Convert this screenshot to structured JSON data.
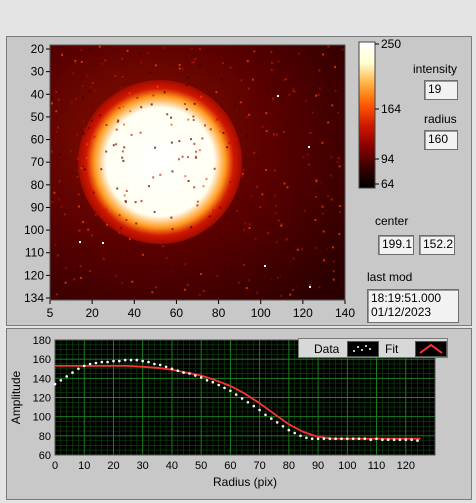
{
  "image_axes": {
    "x_ticks": [
      "5",
      "20",
      "40",
      "60",
      "80",
      "100",
      "120",
      "140"
    ],
    "y_ticks": [
      "20",
      "30",
      "40",
      "50",
      "60",
      "70",
      "80",
      "90",
      "100",
      "110",
      "120",
      "134"
    ]
  },
  "colorbar": {
    "ticks": [
      "250",
      "164",
      "94",
      "64"
    ],
    "colors": [
      "#000000",
      "#3a0000",
      "#8a0000",
      "#d01800",
      "#ff5a00",
      "#ffb040",
      "#ffffd0",
      "#ffffff"
    ]
  },
  "controls": {
    "intensity_label": "intensity",
    "intensity_value": "19",
    "radius_label": "radius",
    "radius_value": "160",
    "center_label": "center",
    "center_x": "199.1",
    "center_y": "152.2",
    "last_mod_label": "last mod",
    "last_mod_time": "18:19:51.000",
    "last_mod_date": "01/12/2023"
  },
  "legend": {
    "data_label": "Data",
    "fit_label": "Fit"
  },
  "chart_data": {
    "type": "scatter",
    "xlabel": "Radius (pix)",
    "ylabel": "Amplitude",
    "xlim": [
      0,
      130
    ],
    "ylim": [
      60,
      180
    ],
    "x_ticks": [
      0,
      10,
      20,
      30,
      40,
      50,
      60,
      70,
      80,
      90,
      100,
      110,
      120
    ],
    "y_ticks": [
      60,
      80,
      100,
      120,
      140,
      160,
      180
    ],
    "grid": true,
    "series": [
      {
        "name": "Data",
        "style": "points",
        "color": "#ffffff",
        "x": [
          0,
          2,
          4,
          6,
          8,
          10,
          12,
          14,
          16,
          18,
          20,
          22,
          24,
          26,
          28,
          30,
          32,
          34,
          36,
          38,
          40,
          42,
          44,
          46,
          48,
          50,
          52,
          54,
          56,
          58,
          60,
          62,
          64,
          66,
          68,
          70,
          72,
          74,
          76,
          78,
          80,
          82,
          84,
          86,
          88,
          90,
          92,
          94,
          96,
          98,
          100,
          102,
          104,
          106,
          108,
          110,
          112,
          114,
          116,
          118,
          120,
          122,
          124
        ],
        "y": [
          134,
          138,
          142,
          146,
          150,
          153,
          155,
          156,
          157,
          157,
          158,
          158,
          159,
          159,
          159,
          158,
          157,
          155,
          154,
          152,
          150,
          148,
          146,
          145,
          143,
          141,
          138,
          136,
          133,
          130,
          127,
          123,
          119,
          115,
          111,
          107,
          102,
          98,
          94,
          90,
          86,
          83,
          80,
          78,
          77,
          77,
          77,
          77,
          77,
          77,
          77,
          77,
          77,
          77,
          76,
          77,
          76,
          76,
          76,
          76,
          76,
          76,
          75
        ]
      },
      {
        "name": "Fit",
        "style": "line",
        "color": "#ff3030",
        "x": [
          0,
          5,
          10,
          15,
          20,
          25,
          30,
          35,
          40,
          45,
          50,
          55,
          60,
          65,
          70,
          75,
          80,
          85,
          90,
          95,
          100,
          105,
          110,
          115,
          120,
          125
        ],
        "y": [
          153,
          153,
          153,
          153,
          153,
          153,
          152,
          151,
          149,
          146,
          143,
          138,
          132,
          124,
          114,
          103,
          92,
          84,
          79,
          77,
          77,
          77,
          77,
          77,
          77,
          77
        ]
      }
    ]
  }
}
